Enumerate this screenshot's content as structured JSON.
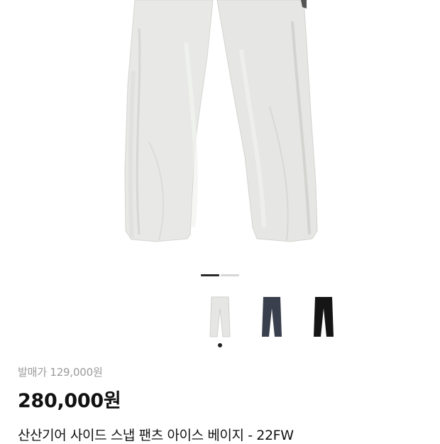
{
  "product": {
    "image_icon": "pants-photo",
    "gallery": {
      "page_count": 2,
      "current_page": 1,
      "active_color": "#2a2a2a",
      "inactive_color": "#d6d6d6"
    },
    "variants": [
      {
        "icon": "pants-icon",
        "color": "#e6e7e4"
      },
      {
        "icon": "pants-icon",
        "color": "#3a3f4d"
      },
      {
        "icon": "pants-icon",
        "color": "#151515"
      }
    ],
    "selected_variant": 0,
    "original_price": "발매가 129,000원",
    "price": "280,000원",
    "title": "산산기어 사이드 스냅 팬츠 아이스 베이지 - 22FW"
  }
}
